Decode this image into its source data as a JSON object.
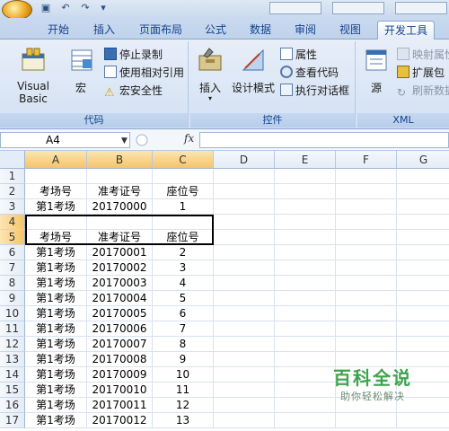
{
  "ribbon_tabs": [
    "开始",
    "插入",
    "页面布局",
    "公式",
    "数据",
    "审阅",
    "视图",
    "开发工具"
  ],
  "active_tab": "开发工具",
  "code_group": {
    "visual_basic": "Visual Basic",
    "macro": "宏",
    "stop_recording": "停止录制",
    "relative_ref": "使用相对引用",
    "macro_security": "宏安全性",
    "label": "代码"
  },
  "controls_group": {
    "insert": "插入",
    "design_mode": "设计模式",
    "properties": "属性",
    "view_code": "查看代码",
    "run_dialog": "执行对话框",
    "label": "控件"
  },
  "xml_group": {
    "source": "源",
    "map_props": "映射属性",
    "expansion": "扩展包",
    "refresh": "刷新数据",
    "label": "XML"
  },
  "name_box": "A4",
  "fx_label": "fx",
  "columns": [
    "A",
    "B",
    "C",
    "D",
    "E",
    "F",
    "G"
  ],
  "rows": [
    {
      "n": "1",
      "a": "",
      "b": "",
      "c": ""
    },
    {
      "n": "2",
      "a": "考场号",
      "b": "准考证号",
      "c": "座位号"
    },
    {
      "n": "3",
      "a": "第1考场",
      "b": "20170000",
      "c": "1"
    },
    {
      "n": "4",
      "a": "",
      "b": "",
      "c": ""
    },
    {
      "n": "5",
      "a": "考场号",
      "b": "准考证号",
      "c": "座位号"
    },
    {
      "n": "6",
      "a": "第1考场",
      "b": "20170001",
      "c": "2"
    },
    {
      "n": "7",
      "a": "第1考场",
      "b": "20170002",
      "c": "3"
    },
    {
      "n": "8",
      "a": "第1考场",
      "b": "20170003",
      "c": "4"
    },
    {
      "n": "9",
      "a": "第1考场",
      "b": "20170004",
      "c": "5"
    },
    {
      "n": "10",
      "a": "第1考场",
      "b": "20170005",
      "c": "6"
    },
    {
      "n": "11",
      "a": "第1考场",
      "b": "20170006",
      "c": "7"
    },
    {
      "n": "12",
      "a": "第1考场",
      "b": "20170007",
      "c": "8"
    },
    {
      "n": "13",
      "a": "第1考场",
      "b": "20170008",
      "c": "9"
    },
    {
      "n": "14",
      "a": "第1考场",
      "b": "20170009",
      "c": "10"
    },
    {
      "n": "15",
      "a": "第1考场",
      "b": "20170010",
      "c": "11"
    },
    {
      "n": "16",
      "a": "第1考场",
      "b": "20170011",
      "c": "12"
    },
    {
      "n": "17",
      "a": "第1考场",
      "b": "20170012",
      "c": "13"
    }
  ],
  "watermark": {
    "title": "百科全说",
    "subtitle": "助你轻松解决"
  }
}
